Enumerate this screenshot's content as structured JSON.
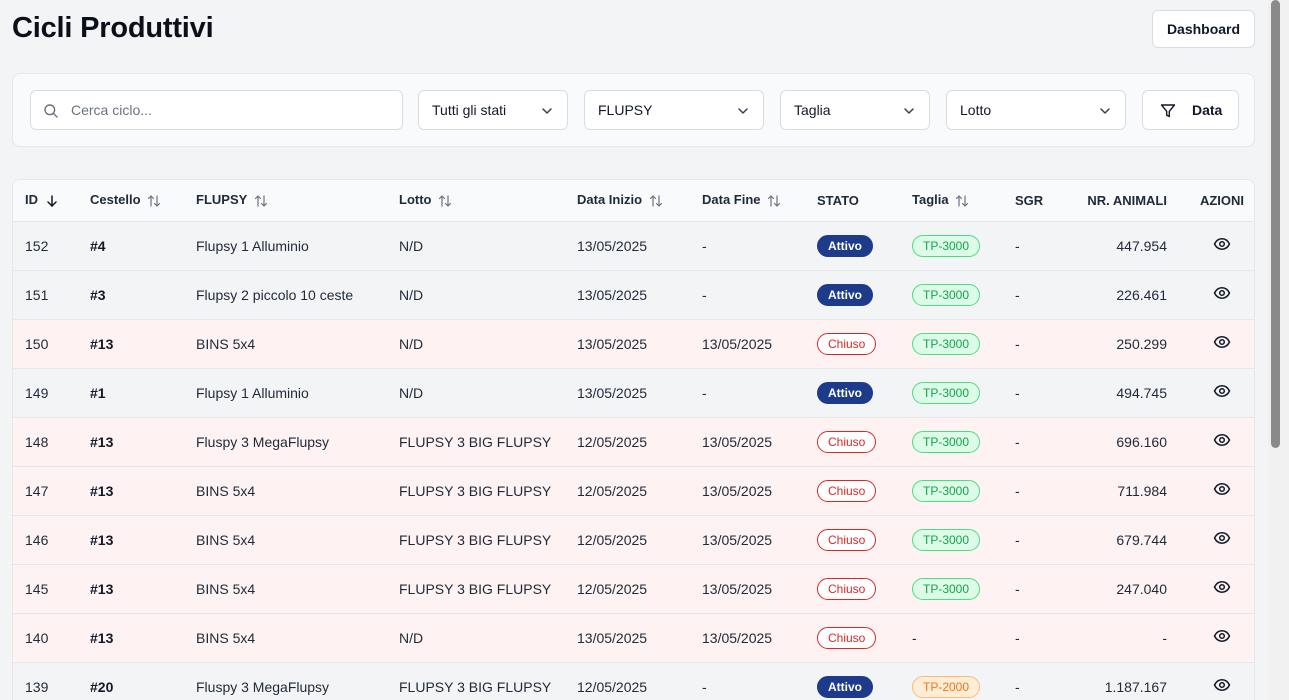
{
  "header": {
    "title": "Cicli Produttivi",
    "dashboard_label": "Dashboard"
  },
  "filters": {
    "search_placeholder": "Cerca ciclo...",
    "state_select": "Tutti gli stati",
    "flupsy_select": "FLUPSY",
    "size_select": "Taglia",
    "lot_select": "Lotto",
    "date_button": "Data"
  },
  "table": {
    "headers": {
      "id": "ID",
      "basket": "Cestello",
      "flupsy": "FLUPSY",
      "lot": "Lotto",
      "start": "Data Inizio",
      "end": "Data Fine",
      "state": "STATO",
      "size": "Taglia",
      "sgr": "SGR",
      "animals": "NR. ANIMALI",
      "actions": "AZIONI"
    },
    "rows": [
      {
        "id": "152",
        "basket": "#4",
        "flupsy": "Flupsy 1 Alluminio",
        "lot": "N/D",
        "start": "13/05/2025",
        "end": "-",
        "state": "Attivo",
        "size": "TP-3000",
        "sgr": "-",
        "animals": "447.954"
      },
      {
        "id": "151",
        "basket": "#3",
        "flupsy": "Flupsy 2 piccolo 10 ceste",
        "lot": "N/D",
        "start": "13/05/2025",
        "end": "-",
        "state": "Attivo",
        "size": "TP-3000",
        "sgr": "-",
        "animals": "226.461"
      },
      {
        "id": "150",
        "basket": "#13",
        "flupsy": "BINS 5x4",
        "lot": "N/D",
        "start": "13/05/2025",
        "end": "13/05/2025",
        "state": "Chiuso",
        "size": "TP-3000",
        "sgr": "-",
        "animals": "250.299"
      },
      {
        "id": "149",
        "basket": "#1",
        "flupsy": "Flupsy 1 Alluminio",
        "lot": "N/D",
        "start": "13/05/2025",
        "end": "-",
        "state": "Attivo",
        "size": "TP-3000",
        "sgr": "-",
        "animals": "494.745"
      },
      {
        "id": "148",
        "basket": "#13",
        "flupsy": "Fluspy 3 MegaFlupsy",
        "lot": "FLUPSY 3 BIG FLUPSY",
        "start": "12/05/2025",
        "end": "13/05/2025",
        "state": "Chiuso",
        "size": "TP-3000",
        "sgr": "-",
        "animals": "696.160"
      },
      {
        "id": "147",
        "basket": "#13",
        "flupsy": "BINS 5x4",
        "lot": "FLUPSY 3 BIG FLUPSY",
        "start": "12/05/2025",
        "end": "13/05/2025",
        "state": "Chiuso",
        "size": "TP-3000",
        "sgr": "-",
        "animals": "711.984"
      },
      {
        "id": "146",
        "basket": "#13",
        "flupsy": "BINS 5x4",
        "lot": "FLUPSY 3 BIG FLUPSY",
        "start": "12/05/2025",
        "end": "13/05/2025",
        "state": "Chiuso",
        "size": "TP-3000",
        "sgr": "-",
        "animals": "679.744"
      },
      {
        "id": "145",
        "basket": "#13",
        "flupsy": "BINS 5x4",
        "lot": "FLUPSY 3 BIG FLUPSY",
        "start": "12/05/2025",
        "end": "13/05/2025",
        "state": "Chiuso",
        "size": "TP-3000",
        "sgr": "-",
        "animals": "247.040"
      },
      {
        "id": "140",
        "basket": "#13",
        "flupsy": "BINS 5x4",
        "lot": "N/D",
        "start": "13/05/2025",
        "end": "13/05/2025",
        "state": "Chiuso",
        "size": "-",
        "sgr": "-",
        "animals": "-"
      },
      {
        "id": "139",
        "basket": "#20",
        "flupsy": "Fluspy 3 MegaFlupsy",
        "lot": "FLUPSY 3 BIG FLUPSY",
        "start": "12/05/2025",
        "end": "-",
        "state": "Attivo",
        "size": "TP-2000",
        "sgr": "-",
        "animals": "1.187.167"
      }
    ]
  },
  "icons": {
    "search": "search-icon",
    "chevron": "chevron-down-icon",
    "filter": "filter-icon",
    "sort": "sort-arrows-icon",
    "sort_desc": "arrow-down-icon",
    "view": "eye-icon"
  },
  "colors": {
    "active_badge": "#1e3a8a",
    "closed_badge": "#dc2626",
    "size_tp3000": "#16a34a",
    "size_tp2000": "#f97316",
    "closed_row_bg": "#fef2f2"
  }
}
